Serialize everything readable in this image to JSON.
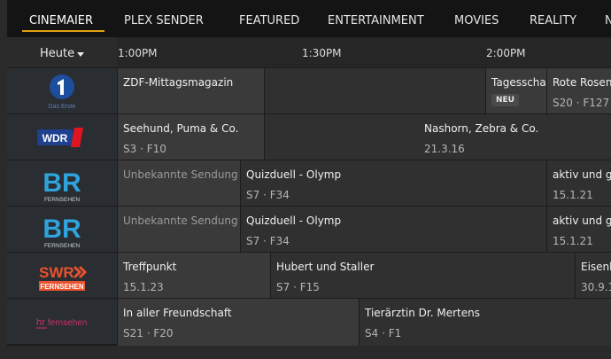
{
  "tabs": [
    "CINEMAIER",
    "PLEX SENDER",
    "FEATURED",
    "ENTERTAINMENT",
    "MOVIES",
    "REALITY",
    "N"
  ],
  "day_label": "Heute",
  "times": [
    "1:00PM",
    "1:30PM",
    "2:00PM"
  ],
  "accent_color": "#e5a00d",
  "channels": [
    {
      "icon": "das-erste-logo-icon",
      "logo_text": "Das Erste"
    },
    {
      "icon": "wdr-logo-icon",
      "logo_text": "WDR"
    },
    {
      "icon": "br-fernsehen-logo-icon",
      "logo_text": "BR",
      "logo_sub": "FERNSEHEN"
    },
    {
      "icon": "br-fernsehen-logo-icon",
      "logo_text": "BR",
      "logo_sub": "FERNSEHEN"
    },
    {
      "icon": "swr-fernsehen-logo-icon",
      "logo_text": "SWR",
      "logo_sub": "FERNSEHEN"
    },
    {
      "icon": "hr-fernsehen-logo-icon",
      "logo_text": "hr",
      "logo_sub": "fernsehen"
    }
  ],
  "rows": [
    [
      {
        "title": "ZDF-Mittagsmagazin",
        "sub": ""
      },
      {
        "title": "",
        "sub": ""
      },
      {
        "title": "Tagesschau",
        "badge": "NEU"
      },
      {
        "title": "Rote Rosen",
        "sub": "S20 · F127"
      }
    ],
    [
      {
        "title": "Seehund, Puma & Co.",
        "sub": "S3 · F10"
      },
      {
        "title": "Nashorn, Zebra & Co.",
        "sub": "21.3.16"
      }
    ],
    [
      {
        "title": "Unbekannte Sendung",
        "sub": ""
      },
      {
        "title": "Quizduell - Olymp",
        "sub": "S7 · F34"
      },
      {
        "title": "aktiv und ge",
        "sub": "15.1.21"
      }
    ],
    [
      {
        "title": "Unbekannte Sendung",
        "sub": ""
      },
      {
        "title": "Quizduell - Olymp",
        "sub": "S7 · F34"
      },
      {
        "title": "aktiv und ge",
        "sub": "15.1.21"
      }
    ],
    [
      {
        "title": "Treffpunkt",
        "sub": "15.1.23"
      },
      {
        "title": "Hubert und Staller",
        "sub": "S7 · F15"
      },
      {
        "title": "Eisenb",
        "sub": "30.9.1"
      }
    ],
    [
      {
        "title": "In aller Freundschaft",
        "sub": "S21 · F20"
      },
      {
        "title": "Tierärztin Dr. Mertens",
        "sub": "S4 · F1"
      }
    ]
  ]
}
